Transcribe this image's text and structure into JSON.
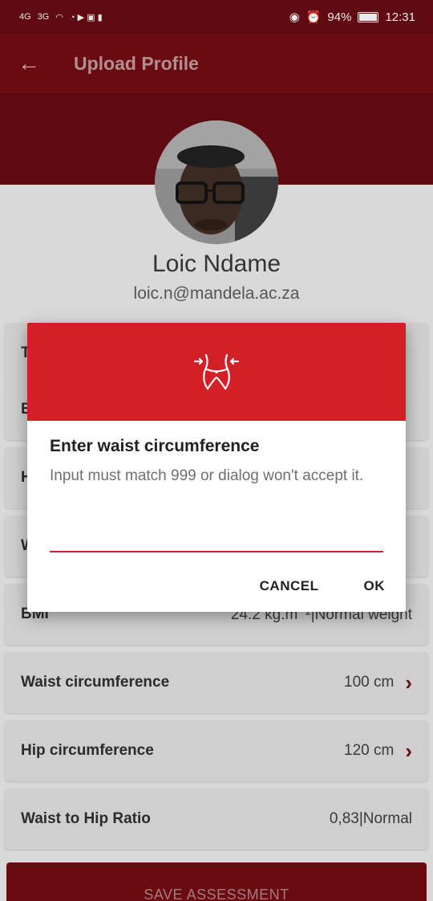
{
  "status_bar": {
    "network_left": "4G",
    "network_right": "3G",
    "battery": "94%",
    "time": "12:31"
  },
  "app_bar": {
    "title": "Upload Profile"
  },
  "profile": {
    "name": "Loic Ndame",
    "email": "loic.n@mandela.ac.za"
  },
  "cards": [
    {
      "label": "T",
      "value": ""
    },
    {
      "label": "E",
      "value": ""
    },
    {
      "label": "H",
      "value": ""
    },
    {
      "label": "W",
      "value": ""
    },
    {
      "label": "BMI",
      "value": "24.2 kg.m⁻²|Normal weight"
    },
    {
      "label": "Waist circumference",
      "value": "100 cm"
    },
    {
      "label": "Hip circumference",
      "value": "120 cm"
    },
    {
      "label": "Waist to Hip Ratio",
      "value": "0,83|Normal"
    }
  ],
  "save_button": "SAVE ASSESSMENT",
  "dialog": {
    "title": "Enter waist circumference",
    "message": "Input must match 999 or dialog won't accept it.",
    "input_value": "",
    "cancel_label": "CANCEL",
    "ok_label": "OK",
    "header_color": "#d32027"
  }
}
